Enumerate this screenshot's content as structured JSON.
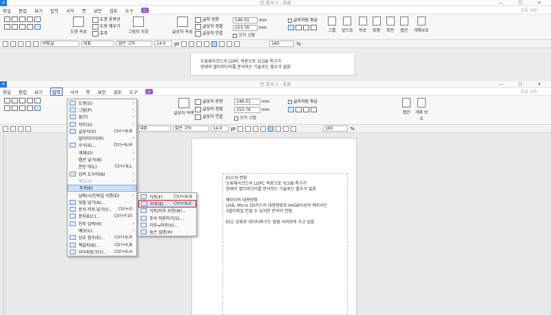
{
  "back_window": {
    "title": "빈 문서 1 - 호글",
    "menu": [
      "파일",
      "편집",
      "보기",
      "입력",
      "서식",
      "쪽",
      "보안",
      "검토",
      "도구"
    ],
    "search_placeholder": "찾을 내용",
    "ribbon": {
      "shape_label": "도형",
      "shape_text_label": "도형 속성",
      "group_label": "그림자 모양",
      "text_box_label": "글상자 속성",
      "insert_shape": "도형 윤곽선",
      "fill_shape": "도형 채우기",
      "shape_effect": "효과",
      "width_value": "146.01",
      "height_value": "153.76",
      "unit": "mm",
      "border_style": "글자 방향",
      "text_align": "글상자 정렬",
      "text_link": "글상자 연결",
      "fixed_size": "크기 고정",
      "text_wrap": "글자처럼 취급",
      "rotate": "회전",
      "right_labels": [
        "그룹",
        "앞으로",
        "뒤로",
        "맞춤",
        "회전",
        "캡션",
        "개체보호"
      ]
    },
    "format_bar": {
      "style": "바탕글",
      "para": "대표",
      "font": "맑은 고딕",
      "size": "14.0",
      "size_unit": "pt",
      "zoom": "160",
      "zoom_unit": "%"
    },
    "doc_lines": [
      "오류제어코드의 LDPC 적용으로 'ICOB 특구가",
      "현재의 멀티미디어를 분석하는 기술로는 할수가 없음"
    ]
  },
  "front_window": {
    "title": "빈 문서 1 - 호글",
    "menu": [
      "파일",
      "편집",
      "보기",
      "입력",
      "서식",
      "쪽",
      "보안",
      "검토",
      "도구"
    ],
    "search_placeholder": "찾을 내용",
    "ribbon": {
      "width_value": "146.01",
      "height_value": "153.76",
      "unit": "mm",
      "text_dir": "글상자 방향",
      "text_align": "글상자 정렬",
      "text_link": "글상자 연결",
      "fixed_size": "크기 고정",
      "text_wrap": "글자처럼 취급",
      "text_box_label": "글상자 여백",
      "caption": "캡션",
      "protect": "개체 보호"
    },
    "format_bar": {
      "style": "대표",
      "font": "맑은 고딕",
      "size": "14.0",
      "size_unit": "pt",
      "zoom": "160",
      "zoom_unit": "%"
    },
    "doc_lines": [
      "ECC의 변화",
      "오류제어코드의 LDPC 적용으로 'ICOB 특구가",
      "현재의 멀티미디어를 분석하는 기술로는 할수가 없음",
      "",
      "메모리의 대용량화",
      "USB, Micro SD카드의 대용량화로 64GB이상의 메모리는",
      "3멀티파일 만들 수 있지만 분석이 안됨",
      "",
      "ECC 강화로 데이터복구는 점점 어려워져 가고 있음"
    ]
  },
  "input_menu": {
    "items": [
      {
        "label": "도형(G)",
        "shortcut": "",
        "arrow": true,
        "disabled": false
      },
      {
        "label": "그림(P)",
        "shortcut": "",
        "arrow": true,
        "disabled": false
      },
      {
        "label": "표(T)",
        "shortcut": "",
        "arrow": true,
        "disabled": false
      },
      {
        "label": "차트(U)",
        "shortcut": "",
        "arrow": true,
        "disabled": false
      },
      {
        "label": "글상자(X)",
        "shortcut": "Ctrl+N,B",
        "arrow": false,
        "disabled": false
      },
      {
        "label": "멀티미디어(R)",
        "shortcut": "",
        "arrow": true,
        "disabled": false
      },
      {
        "label": "수식(S)...",
        "shortcut": "Ctrl+N,M",
        "arrow": false,
        "disabled": false
      },
      {
        "label": "개체(O)",
        "shortcut": "",
        "arrow": true,
        "disabled": false
      },
      {
        "label": "캡션 넣기(M)",
        "shortcut": "",
        "arrow": true,
        "disabled": false
      },
      {
        "label": "문단 띠(L)",
        "shortcut": "Ctrl+N,L",
        "arrow": false,
        "disabled": false
      },
      {
        "label": "입력 도우미(N)",
        "shortcut": "",
        "arrow": true,
        "disabled": false
      },
      {
        "label": "메모(V)",
        "shortcut": "",
        "arrow": true,
        "disabled": true
      },
      {
        "label": "주석(K)",
        "shortcut": "",
        "arrow": true,
        "disabled": false,
        "highlight": true
      },
      {
        "label": "날짜/시간/파일 이름(D)",
        "shortcut": "",
        "arrow": true,
        "disabled": false
      },
      {
        "label": "덧말 넣기(A)...",
        "shortcut": "",
        "arrow": false,
        "disabled": false
      },
      {
        "label": "문서 끼워 넣기(I)...",
        "shortcut": "Ctrl+O",
        "arrow": false,
        "disabled": false
      },
      {
        "label": "문자표(C)...",
        "shortcut": "Ctrl+F10",
        "arrow": false,
        "disabled": false
      },
      {
        "label": "한자 입력(H)",
        "shortcut": "",
        "arrow": true,
        "disabled": false
      },
      {
        "label": "메모(U)",
        "shortcut": "",
        "arrow": true,
        "disabled": false
      },
      {
        "label": "상호 참조(E)...",
        "shortcut": "Ctrl+K,R",
        "arrow": false,
        "disabled": false
      },
      {
        "label": "책갈피(B)...",
        "shortcut": "Ctrl+K,B",
        "arrow": false,
        "disabled": false
      },
      {
        "label": "하이퍼링크(Y)...",
        "shortcut": "Ctrl+K,H",
        "arrow": false,
        "disabled": false
      }
    ]
  },
  "annotation_submenu": {
    "items": [
      {
        "label": "각주(F)",
        "shortcut": "Ctrl+N,N",
        "selected": false
      },
      {
        "label": "미주(E)",
        "shortcut": "Ctrl+N,E",
        "selected": true
      },
      {
        "label": "각주/미주 모양(M)...",
        "shortcut": "",
        "selected": false
      },
      {
        "label": "주석 저장하기(S)...",
        "shortcut": "",
        "selected": false
      },
      {
        "label": "각주↔미주(V)...",
        "shortcut": "",
        "selected": false
      },
      {
        "label": "숨은 설명(H)",
        "shortcut": "",
        "selected": false
      }
    ]
  }
}
